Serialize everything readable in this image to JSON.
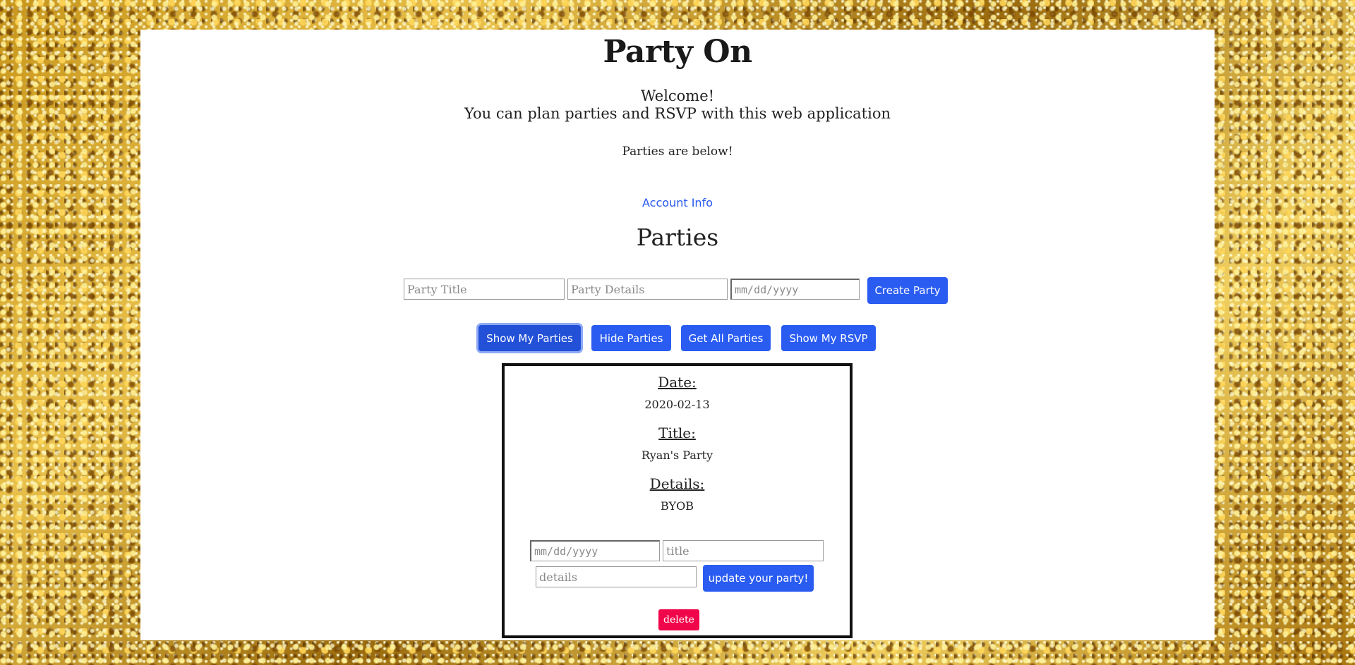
{
  "header": {
    "title": "Party On",
    "welcome_line1": "Welcome!",
    "welcome_line2": "You can plan parties and RSVP with this web application",
    "subtext": "Parties are below!",
    "account_link": "Account Info"
  },
  "parties_section": {
    "title": "Parties",
    "create_form": {
      "title_placeholder": "Party Title",
      "details_placeholder": "Party Details",
      "date_placeholder": "mm/dd/yyyy",
      "create_button": "Create Party"
    },
    "actions": {
      "show_my_parties": "Show My Parties",
      "hide_parties": "Hide Parties",
      "get_all_parties": "Get All Parties",
      "show_my_rsvp": "Show My RSVP"
    }
  },
  "party_card": {
    "date_label": "Date:",
    "date_value": "2020-02-13",
    "title_label": "Title:",
    "title_value": "Ryan's Party",
    "details_label": "Details:",
    "details_value": "BYOB",
    "update_form": {
      "date_placeholder": "mm/dd/yyyy",
      "title_placeholder": "title",
      "details_placeholder": "details",
      "update_button": "update your party!"
    },
    "delete_button": "delete"
  },
  "colors": {
    "button_blue": "#2a5cf2",
    "delete_red": "#f0064a",
    "link_blue": "#2757f0",
    "background_gold": "#c8961c"
  }
}
